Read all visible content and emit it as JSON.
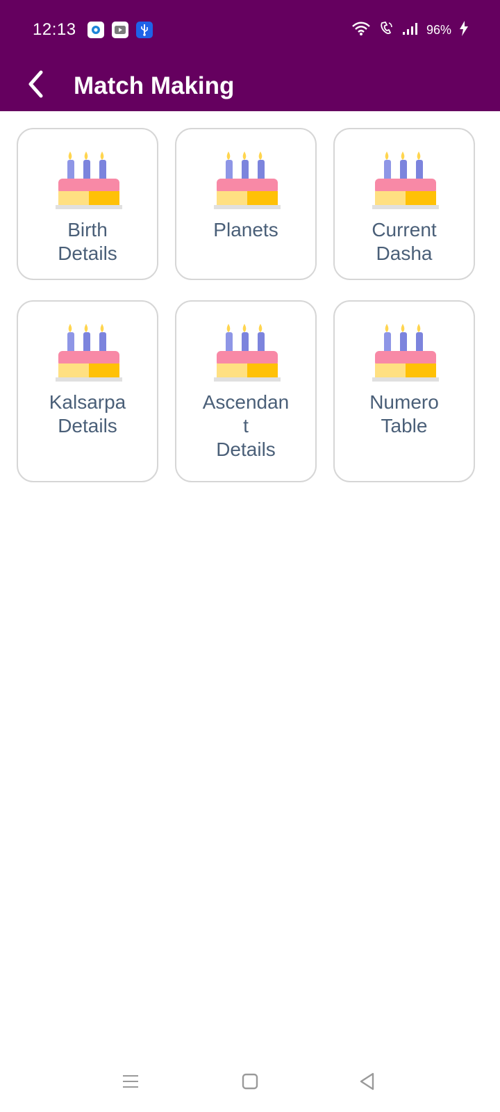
{
  "status_bar": {
    "time": "12:13",
    "battery": "96%",
    "colors": {
      "background": "#65005f",
      "foreground": "#ffffff"
    },
    "app_icons": [
      "circle-app-icon",
      "youtube-icon",
      "usb-icon"
    ],
    "system_icons": [
      "wifi-icon",
      "wifi-calling-icon",
      "signal-icon",
      "charging-icon"
    ]
  },
  "app_bar": {
    "title": "Match Making",
    "back_icon": "chevron-left-icon",
    "background_color": "#65005f"
  },
  "grid": {
    "icon": "birthday-cake-icon",
    "items": [
      {
        "label": "Birth\nDetails"
      },
      {
        "label": "Planets"
      },
      {
        "label": "Current\nDasha"
      },
      {
        "label": "Kalsarpa\nDetails"
      },
      {
        "label": "Ascendan\nt\nDetails"
      },
      {
        "label": "Numero\nTable"
      }
    ],
    "text_color": "#4a5f78",
    "border_color": "#d6d6d6"
  },
  "navigation_bar": {
    "items": [
      "menu-icon",
      "home-square-icon",
      "back-triangle-icon"
    ]
  }
}
